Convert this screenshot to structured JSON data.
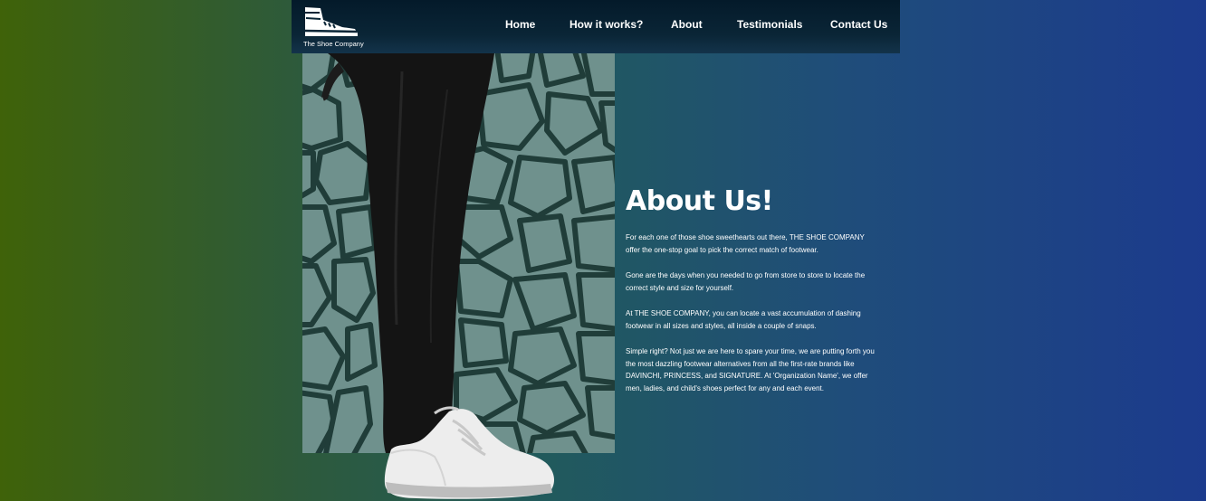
{
  "nav": {
    "logo_text": "The Shoe Company",
    "links": [
      {
        "label": "Home"
      },
      {
        "label": "How it works?"
      },
      {
        "label": "About"
      },
      {
        "label": "Testimonials"
      },
      {
        "label": "Contact Us"
      }
    ]
  },
  "about": {
    "title": "About Us!",
    "paragraphs": [
      "For each one of those shoe sweethearts out there, THE SHOE COMPANY offer the one-stop goal to pick the correct match of footwear.",
      "Gone are the days when you needed to go from store to store to locate the correct style and size for yourself.",
      "At THE SHOE COMPANY, you can locate a vast accumulation of dashing footwear in all sizes and styles, all inside a couple of snaps.",
      "Simple right? Not just we are here to spare your time, we are putting forth you the most dazzling footwear alternatives from all the first-rate brands like DAVINCHI, PRINCESS, and SIGNATURE. At 'Organization Name', we offer men, ladies, and child's shoes perfect for any and each event."
    ]
  },
  "colors": {
    "gradient_left": "#3f6209",
    "gradient_right": "#1c3b8d",
    "navbar": "#041a2a",
    "stone": "#6f918d",
    "grout": "#203d39"
  }
}
